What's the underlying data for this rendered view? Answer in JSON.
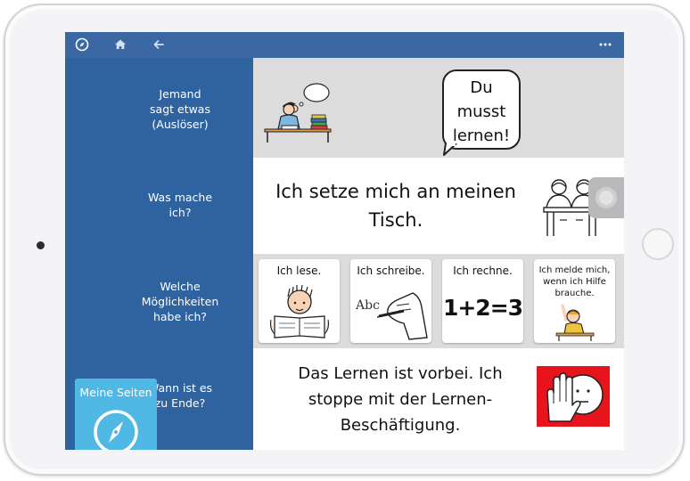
{
  "sidebar": {
    "rows": [
      {
        "label": "Jemand\nsagt etwas\n(Auslöser)"
      },
      {
        "label": "Was mache\nich?"
      },
      {
        "label": "Welche\nMöglichkeiten\nhabe ich?"
      },
      {
        "label": "Wann ist es\nzu Ende?"
      }
    ],
    "meine_seiten": "Meine Seiten"
  },
  "content": {
    "speech": [
      "Du",
      "musst",
      "lernen!"
    ],
    "action_text": "Ich setze mich an meinen Tisch.",
    "options": [
      {
        "label": "Ich lese."
      },
      {
        "label": "Ich schreibe.",
        "pictogram_text": "Abc"
      },
      {
        "label": "Ich rechne.",
        "pictogram_text": "1+2=3"
      },
      {
        "label": "Ich melde mich, wenn ich Hilfe brauche."
      }
    ],
    "end_text": "Das Lernen ist vorbei. Ich stoppe mit der Lernen-Beschäftigung."
  },
  "colors": {
    "topbar": "#3b68a3",
    "sidebar": "#2f63a0",
    "meine_seiten": "#4fb8e4",
    "stop_card": "#e8141b"
  }
}
